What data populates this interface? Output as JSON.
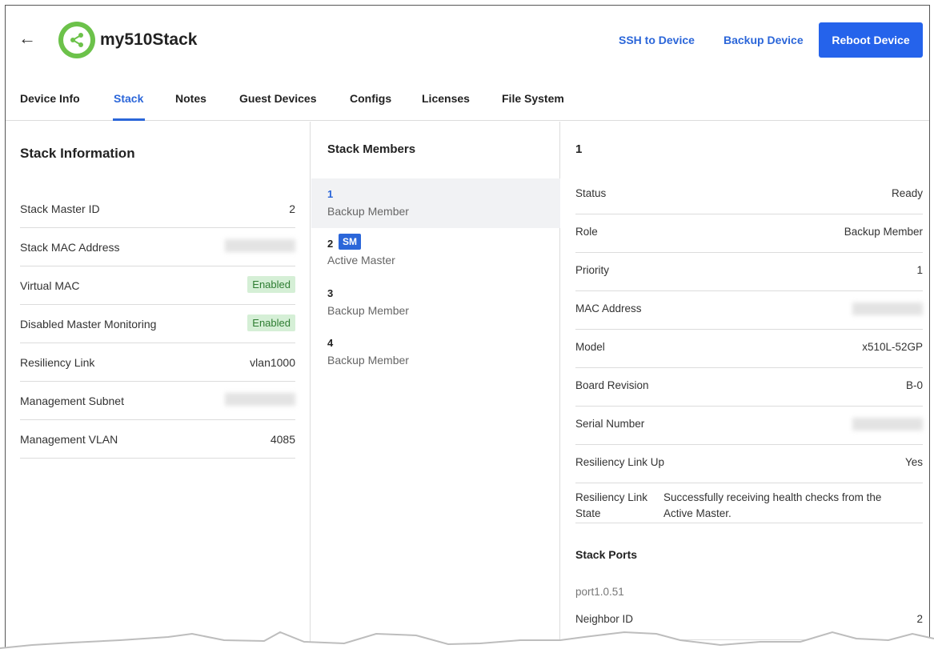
{
  "header": {
    "back_glyph": "←",
    "device_name": "my510Stack",
    "ssh_label": "SSH to Device",
    "backup_label": "Backup Device",
    "reboot_label": "Reboot Device",
    "logo_icon": "share-icon",
    "brand_color": "#6cc24a",
    "accent_color": "#2563eb"
  },
  "tabs": [
    {
      "label": "Device Info",
      "active": false
    },
    {
      "label": "Stack",
      "active": true
    },
    {
      "label": "Notes",
      "active": false
    },
    {
      "label": "Guest Devices",
      "active": false
    },
    {
      "label": "Configs",
      "active": false
    },
    {
      "label": "Licenses",
      "active": false
    },
    {
      "label": "File System",
      "active": false
    }
  ],
  "stack_info": {
    "title": "Stack Information",
    "rows": [
      {
        "label": "Stack Master ID",
        "value": "2"
      },
      {
        "label": "Stack MAC Address",
        "value": ""
      },
      {
        "label": "Virtual MAC",
        "value": "Enabled"
      },
      {
        "label": "Disabled Master Monitoring",
        "value": "Enabled"
      },
      {
        "label": "Resiliency Link",
        "value": "vlan1000"
      },
      {
        "label": "Management Subnet",
        "value": ""
      },
      {
        "label": "Management VLAN",
        "value": "4085"
      }
    ]
  },
  "stack_members": {
    "title": "Stack Members",
    "items": [
      {
        "id": "1",
        "role": "Backup Member",
        "selected": true,
        "badge": ""
      },
      {
        "id": "2",
        "role": "Active Master",
        "selected": false,
        "badge": "SM"
      },
      {
        "id": "3",
        "role": "Backup Member",
        "selected": false,
        "badge": ""
      },
      {
        "id": "4",
        "role": "Backup Member",
        "selected": false,
        "badge": ""
      }
    ]
  },
  "member_detail": {
    "title": "1",
    "rows": [
      {
        "label": "Status",
        "value": "Ready"
      },
      {
        "label": "Role",
        "value": "Backup Member"
      },
      {
        "label": "Priority",
        "value": "1"
      },
      {
        "label": "MAC Address",
        "value": ""
      },
      {
        "label": "Model",
        "value": "x510L-52GP"
      },
      {
        "label": "Board Revision",
        "value": "B-0"
      },
      {
        "label": "Serial Number",
        "value": ""
      },
      {
        "label": "Resiliency Link Up",
        "value": "Yes"
      }
    ],
    "resiliency_state_label": "Resiliency Link State",
    "resiliency_state_value": "Successfully receiving health checks from the Active Master.",
    "stack_ports_title": "Stack Ports",
    "port_name": "port1.0.51",
    "neighbor_label": "Neighbor ID",
    "neighbor_value": "2"
  }
}
